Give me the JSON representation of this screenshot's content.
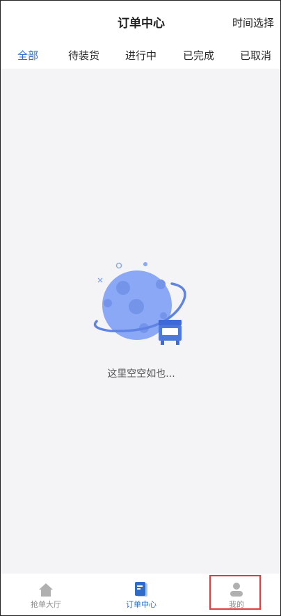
{
  "header": {
    "title": "订单中心",
    "right_action": "时间选择"
  },
  "tabs": [
    {
      "label": "全部",
      "active": true
    },
    {
      "label": "待装货",
      "active": false
    },
    {
      "label": "进行中",
      "active": false
    },
    {
      "label": "已完成",
      "active": false
    },
    {
      "label": "已取消",
      "active": false
    }
  ],
  "empty_state": {
    "message": "这里空空如也...",
    "icon": "planet-truck-illustration"
  },
  "bottom_nav": [
    {
      "label": "抢单大厅",
      "icon": "home-icon",
      "active": false
    },
    {
      "label": "订单中心",
      "icon": "order-icon",
      "active": true
    },
    {
      "label": "我的",
      "icon": "user-icon",
      "active": false
    }
  ],
  "colors": {
    "accent": "#2f6cc8",
    "planet": "#8aa8f5",
    "highlight": "#e23b3b",
    "background": "#f4f4f6"
  }
}
